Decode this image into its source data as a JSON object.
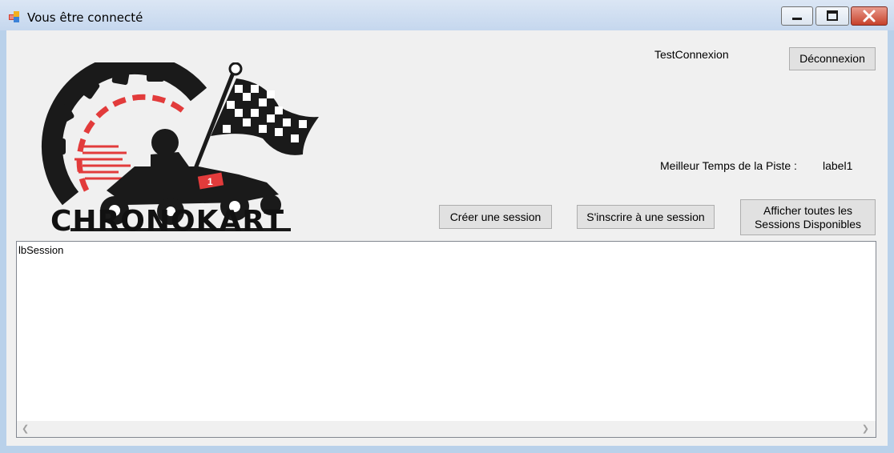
{
  "window": {
    "title": "Vous être connecté",
    "icons": {
      "app": "app-icon",
      "minimize": "minimize-icon",
      "maximize": "maximize-icon",
      "close": "close-icon"
    }
  },
  "header": {
    "user_label": "TestConnexion",
    "logout_button": "Déconnexion"
  },
  "logo": {
    "text": "CHRONOKART",
    "accent": "#e23b3b"
  },
  "best_time": {
    "label": "Meilleur Temps de la Piste :",
    "value": "label1"
  },
  "actions": {
    "create_session": "Créer une session",
    "register_session": "S'inscrire à une session",
    "show_all_line1": "Afficher toutes les",
    "show_all_line2": "Sessions Disponibles"
  },
  "session_list": {
    "items": [
      "lbSession"
    ]
  }
}
